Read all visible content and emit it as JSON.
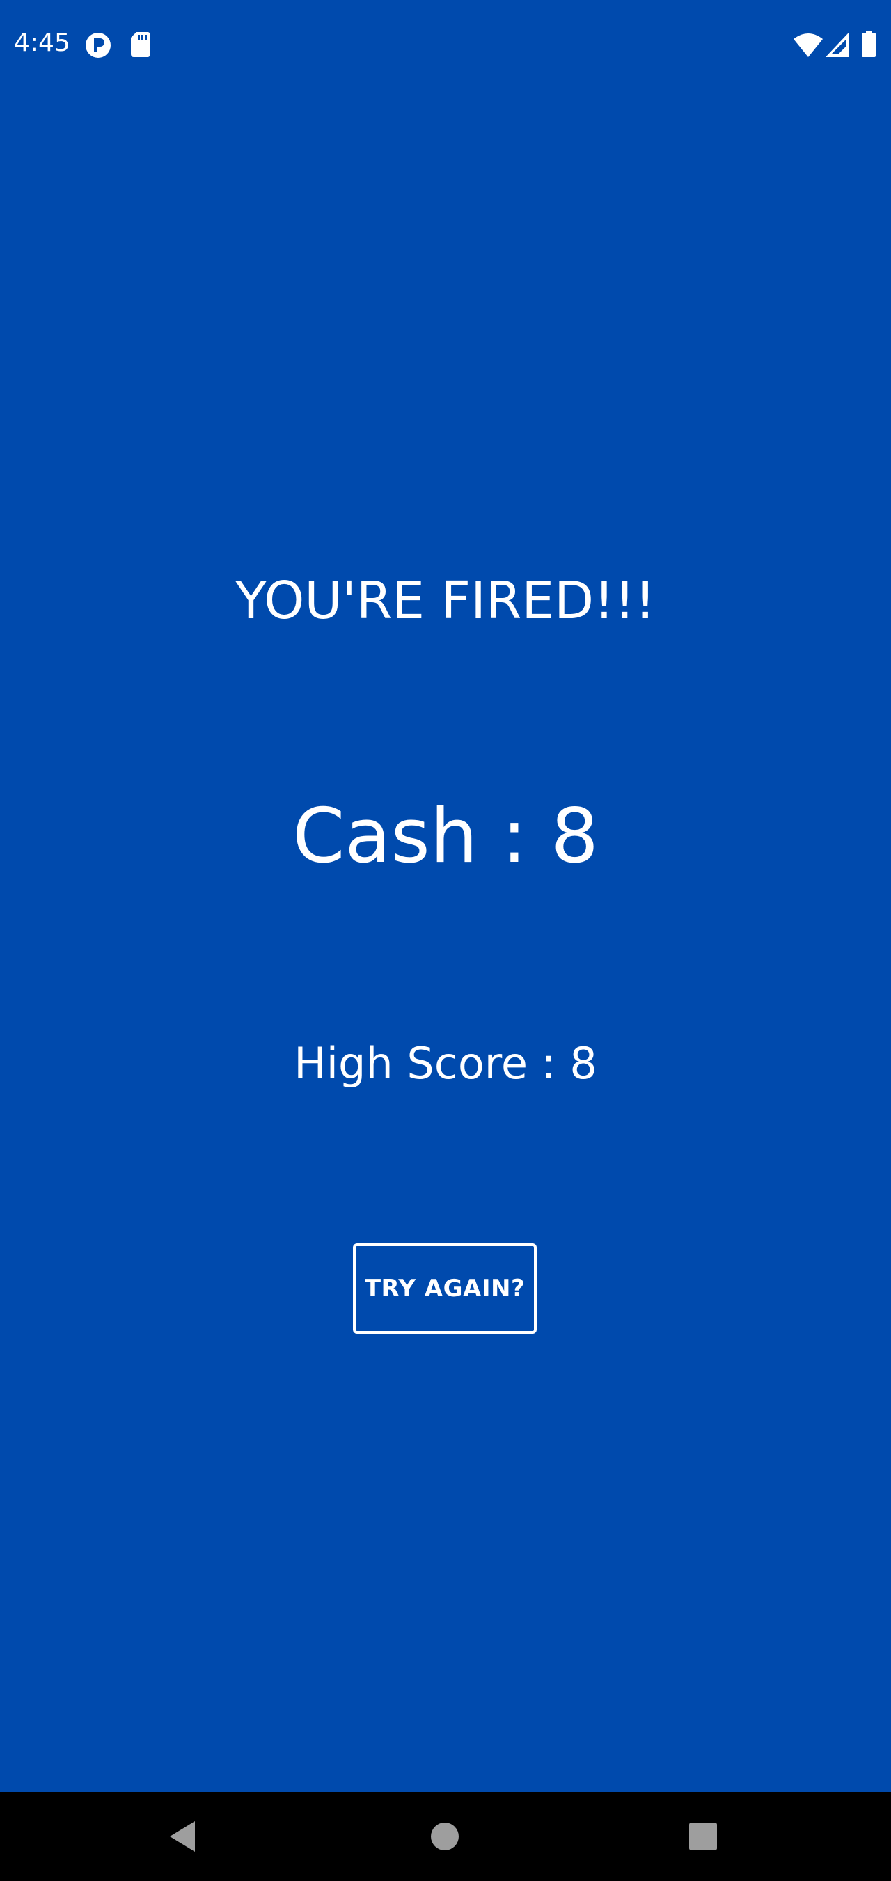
{
  "status_bar": {
    "time": "4:45",
    "left_icons": [
      "p-app-icon",
      "sd-card-icon"
    ],
    "right_icons": [
      "wifi-icon",
      "signal-icon",
      "battery-icon"
    ]
  },
  "game_over": {
    "headline": "YOU'RE FIRED!!!",
    "cash_text": "Cash : 8",
    "high_score_text": "High Score : 8",
    "try_again_label": "TRY AGAIN?"
  },
  "nav_bar": {
    "buttons": [
      "back-icon",
      "home-icon",
      "recents-icon"
    ]
  },
  "colors": {
    "background": "#004AAD",
    "text": "#FFFFFF",
    "nav_bar": "#000000",
    "nav_icons": "#9E9E9E"
  }
}
